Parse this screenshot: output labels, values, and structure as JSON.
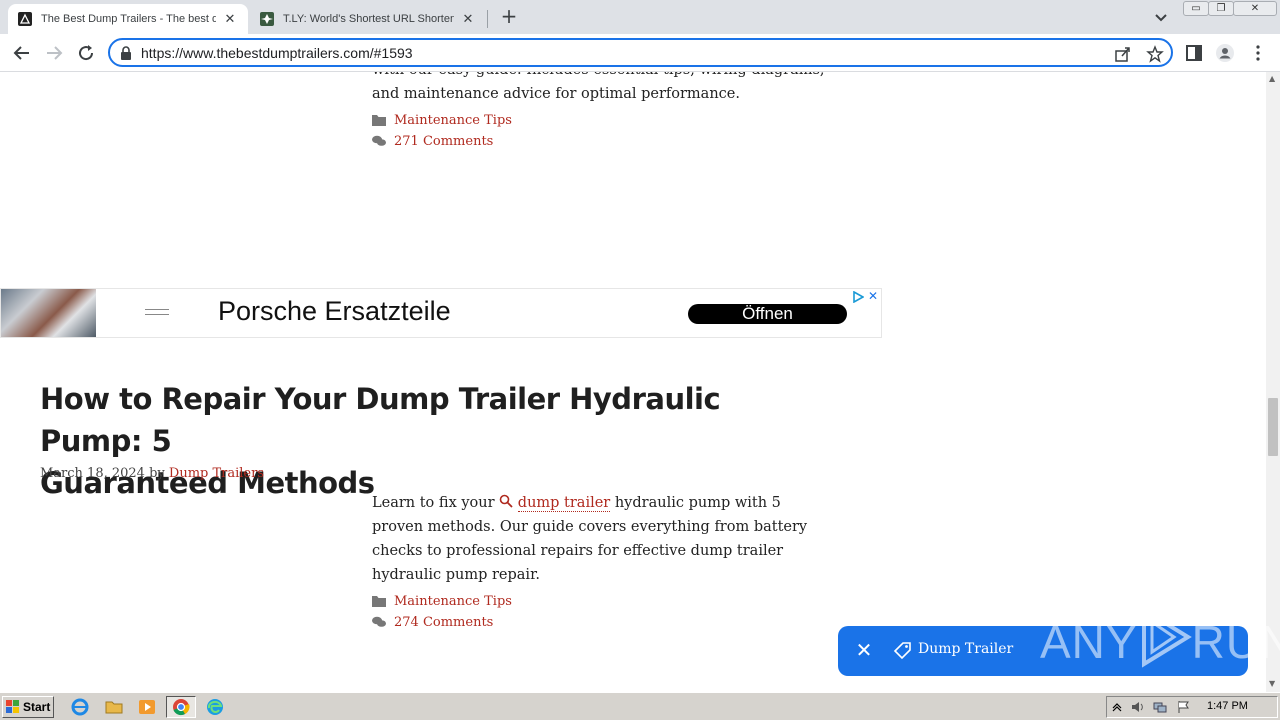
{
  "browser": {
    "tabs": [
      {
        "title": "The Best Dump Trailers - The best du",
        "active": true
      },
      {
        "title": "T.LY: World's Shortest URL Shortene",
        "active": false
      }
    ],
    "new_tab_symbol": "+",
    "tab_close_symbol": "✕",
    "url": "https://www.thebestdumptrailers.com/#1593",
    "window_controls": {
      "minimize": "▭",
      "restore": "❐",
      "close": "✕"
    }
  },
  "page": {
    "prev_post": {
      "excerpt_tail_1": "with our easy guide. Includes essential tips, wiring diagrams,",
      "excerpt_tail_2": "and maintenance advice for optimal performance.",
      "category": "Maintenance Tips",
      "comments": "271 Comments"
    },
    "ad": {
      "headline": "Porsche Ersatzteile",
      "cta": "Öffnen",
      "close": "✕"
    },
    "post": {
      "title_line1": "How to Repair Your Dump Trailer Hydraulic Pump: 5",
      "title_line2": "Guaranteed Methods",
      "date": "March 18, 2024",
      "by": "by",
      "author": "Dump Trailers",
      "excerpt_before": "Learn to fix your",
      "keyword": "dump trailer",
      "excerpt_after": "hydraulic pump with 5",
      "excerpt_line2": "proven methods. Our guide covers everything from battery",
      "excerpt_line3": "checks to professional repairs for effective dump trailer",
      "excerpt_line4": "hydraulic pump repair.",
      "category": "Maintenance Tips",
      "comments": "274 Comments"
    },
    "keyword_pill": {
      "close": "✕",
      "label": "Dump Trailer"
    },
    "watermark": {
      "left": "ANY",
      "right": "RUN"
    }
  },
  "taskbar": {
    "start_label": "Start",
    "clock": "1:47 PM"
  },
  "colors": {
    "link": "#b02a1f",
    "accent": "#1a73e8"
  }
}
